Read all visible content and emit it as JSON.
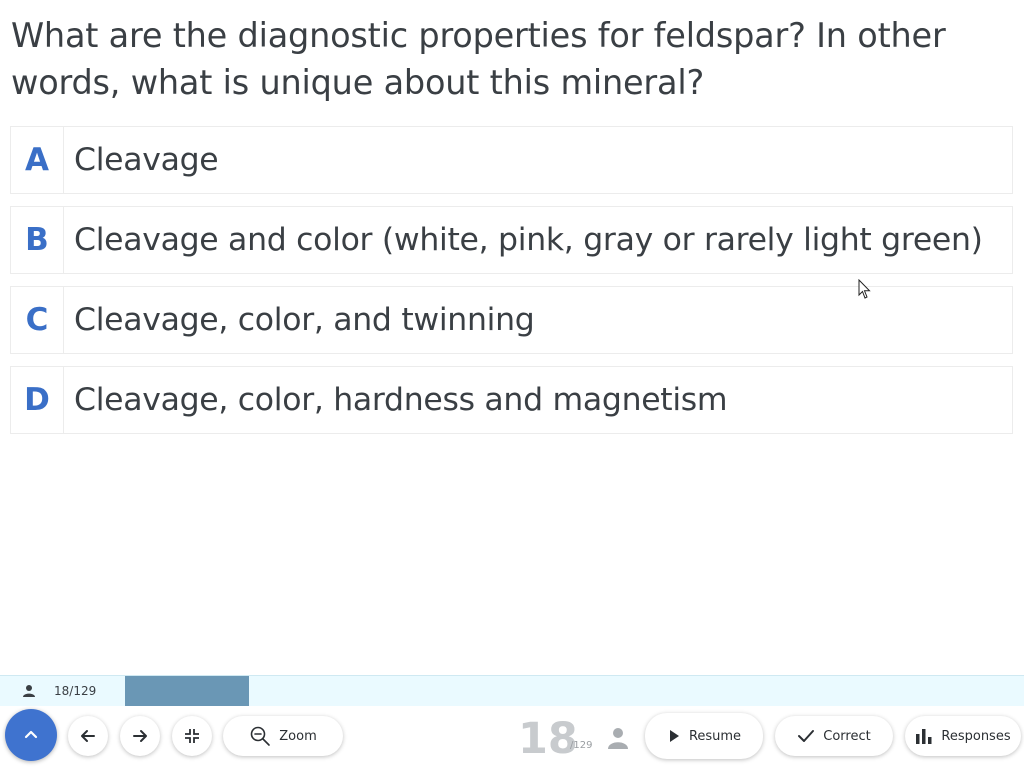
{
  "question": {
    "text": "What are the diagnostic properties for feldspar?  In other words, what is unique about this mineral?"
  },
  "options": [
    {
      "letter": "A",
      "text": "Cleavage"
    },
    {
      "letter": "B",
      "text": "Cleavage and color (white, pink, gray or rarely light green)"
    },
    {
      "letter": "C",
      "text": "Cleavage, color, and twinning"
    },
    {
      "letter": "D",
      "text": "Cleavage, color, hardness and magnetism"
    }
  ],
  "progress": {
    "label": "18/129",
    "fraction": 0.1395
  },
  "toolbar": {
    "zoom_label": "Zoom",
    "resume_label": "Resume",
    "correct_label": "Correct",
    "responses_label": "Responses"
  },
  "counter": {
    "current": "18",
    "total": "/129"
  },
  "colors": {
    "accent": "#3f73cf",
    "letter": "#3a6fc7",
    "progress_fill": "#6a97b5",
    "progress_track": "#eafaff"
  }
}
